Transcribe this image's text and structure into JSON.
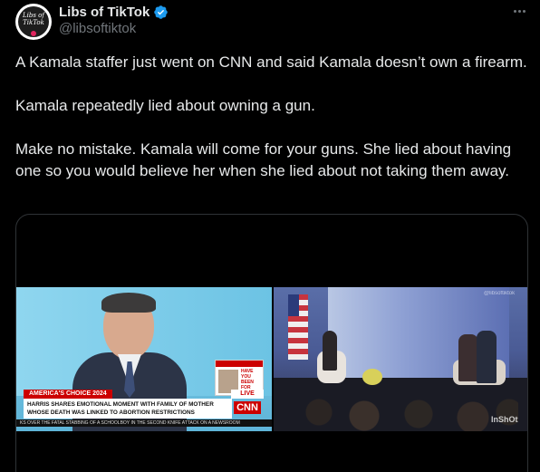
{
  "author": {
    "display_name": "Libs of TikTok",
    "handle": "@libsoftiktok",
    "avatar_text_line1": "Libs of",
    "avatar_text_line2": "TikTok"
  },
  "tweet": {
    "paragraphs": [
      "A Kamala staffer just went on CNN and said Kamala doesn’t own a firearm.",
      "Kamala repeatedly lied about owning a gun.",
      "Make no mistake. Kamala will come for your guns. She lied about having one so you would believe her when she lied about not taking them away."
    ]
  },
  "video": {
    "cnn": {
      "promo_text": "HAVE YOU BEEN FOR THIS?",
      "live_label": "LIVE",
      "section_label": "AMERICA'S CHOICE 2024",
      "headline_line1": "HARRIS SHARES EMOTIONAL MOMENT WITH FAMILY OF MOTHER",
      "headline_line2": "WHOSE DEATH WAS LINKED TO ABORTION RESTRICTIONS",
      "logo": "CNN",
      "ticker": "KS OVER THE FATAL STABBING OF A SCHOOLBOY IN THE SECOND KNIFE ATTACK ON A NEWSROOM"
    },
    "watermark": "@libsoftiktok",
    "inshot_watermark": "InShOt"
  },
  "colors": {
    "background": "#000000",
    "text": "#e7e9ea",
    "muted": "#71767b",
    "verified": "#1d9bf0",
    "cnn_red": "#cc0000"
  },
  "icons": {
    "verified": "verified-badge-icon",
    "more": "more-options-icon"
  }
}
